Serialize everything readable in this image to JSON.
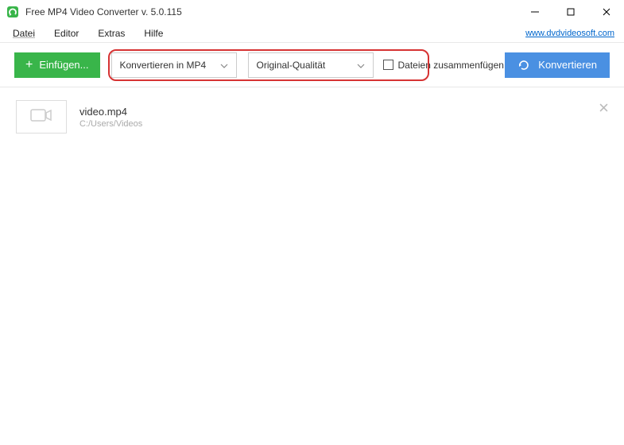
{
  "window": {
    "title": "Free MP4 Video Converter v. 5.0.115"
  },
  "menubar": {
    "items": [
      "Datei",
      "Editor",
      "Extras",
      "Hilfe"
    ],
    "link": "www.dvdvideosoft.com"
  },
  "toolbar": {
    "add_label": "Einfügen...",
    "format_select": "Konvertieren in MP4",
    "quality_select": "Original-Qualität",
    "merge_label": "Dateien zusammenfügen",
    "convert_label": "Konvertieren"
  },
  "files": [
    {
      "name": "video.mp4",
      "path": "C:/Users/Videos"
    }
  ]
}
